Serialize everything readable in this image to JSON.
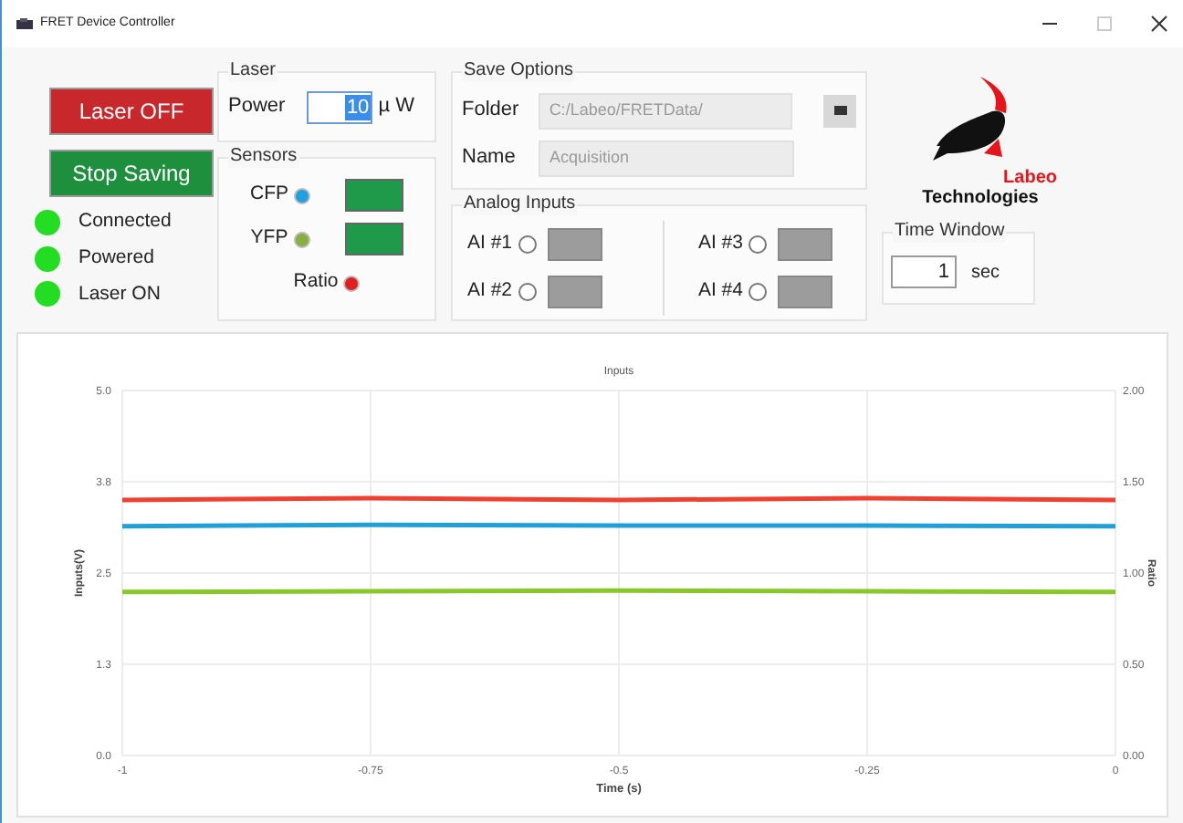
{
  "window": {
    "title": "FRET Device Controller"
  },
  "controls": {
    "laser_button": "Laser OFF",
    "saving_button": "Stop Saving"
  },
  "status": [
    {
      "label": "Connected",
      "on": true
    },
    {
      "label": "Powered",
      "on": true
    },
    {
      "label": "Laser ON",
      "on": true
    }
  ],
  "laser": {
    "title": "Laser",
    "label": "Power",
    "value": "10",
    "unit": "µ W"
  },
  "sensors": {
    "title": "Sensors",
    "items": [
      {
        "label": "CFP",
        "color": "#1fa0e0",
        "kind": "toggle"
      },
      {
        "label": "YFP",
        "color": "#88b040",
        "kind": "toggle"
      },
      {
        "label": "Ratio",
        "color": "#e02020",
        "kind": "plain"
      }
    ]
  },
  "save_options": {
    "title": "Save Options",
    "folder_label": "Folder",
    "folder_value": "C:/Labeo/FRETData/",
    "name_label": "Name",
    "name_value": "Acquisition"
  },
  "analog_inputs": {
    "title": "Analog Inputs",
    "items": [
      {
        "label": "AI #1",
        "checked": false
      },
      {
        "label": "AI #2",
        "checked": false
      },
      {
        "label": "AI #3",
        "checked": false
      },
      {
        "label": "AI #4",
        "checked": false
      }
    ]
  },
  "logo": {
    "line1": "Labeo",
    "line2": "Technologies"
  },
  "time_window": {
    "title": "Time Window",
    "value": "1",
    "unit": "sec"
  },
  "chart": {
    "chart_data": {
      "type": "line",
      "title": "Inputs",
      "xlabel": "Time (s)",
      "ylabel": "Inputs(V)",
      "y2label": "Ratio",
      "x": [
        -1,
        -0.75,
        -0.5,
        -0.25,
        0
      ],
      "xlim": [
        -1,
        0
      ],
      "ylim": [
        0,
        5
      ],
      "xticks": [
        {
          "value": -1,
          "label": "-1"
        },
        {
          "value": -0.75,
          "label": "-0.75"
        },
        {
          "value": -0.5,
          "label": "-0.5"
        },
        {
          "value": -0.25,
          "label": "-0.25"
        },
        {
          "value": 0,
          "label": "0"
        }
      ],
      "yticks": [
        {
          "value": 0,
          "label": "0.0"
        },
        {
          "value": 1.25,
          "label": "1.3"
        },
        {
          "value": 2.5,
          "label": "2.5"
        },
        {
          "value": 3.75,
          "label": "3.8"
        },
        {
          "value": 5,
          "label": "5.0"
        }
      ],
      "y2ticks": [
        {
          "value": 0,
          "label": "0.00"
        },
        {
          "value": 0.5,
          "label": "0.50"
        },
        {
          "value": 1,
          "label": "1.00"
        },
        {
          "value": 1.5,
          "label": "1.50"
        },
        {
          "value": 2,
          "label": "2.00"
        }
      ],
      "y2lim": [
        0,
        2
      ],
      "grid": true,
      "series": [
        {
          "color": "#f04030",
          "axis": "y2",
          "values": [
            1.4,
            1.41,
            1.4,
            1.41,
            1.4
          ]
        },
        {
          "color": "#20a0d8",
          "values": [
            3.14,
            3.16,
            3.15,
            3.15,
            3.14
          ]
        },
        {
          "color": "#88c828",
          "values": [
            2.24,
            2.25,
            2.26,
            2.25,
            2.24
          ]
        }
      ]
    }
  }
}
